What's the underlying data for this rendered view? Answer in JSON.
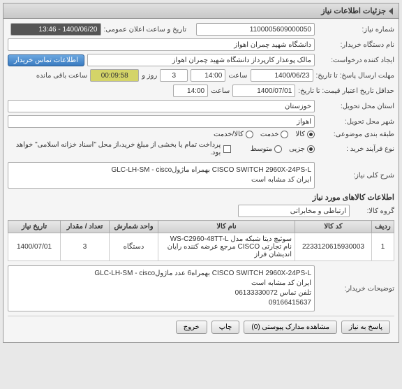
{
  "panel_title": "جزئیات اطلاعات نیاز",
  "fields": {
    "need_no_label": "شماره نیاز:",
    "need_no": "1100005609000050",
    "announce_label": "تاریخ و ساعت اعلان عمومی:",
    "announce": "1400/06/20 - 13:46",
    "buyer_org_label": "نام دستگاه خریدار:",
    "buyer_org": "دانشگاه شهید چمران اهواز",
    "creator_label": "ایجاد کننده درخواست:",
    "creator": "مالک پوعذار کارپرداز دانشگاه شهید چمران اهواز",
    "creator_btn": "اطلاعات تماس خریدار",
    "deadline_label": "مهلت ارسال پاسخ: تا تاریخ:",
    "deadline_date": "1400/06/23",
    "time_label": "ساعت",
    "deadline_time": "14:00",
    "days_label": "روز و",
    "days": "3",
    "remaining": "00:09:58",
    "remaining_label": "ساعت باقی مانده",
    "validity_label": "حداقل تاریخ اعتبار قیمت: تا تاریخ:",
    "validity_date": "1400/07/01",
    "validity_time": "14:00",
    "province_label": "استان محل تحویل:",
    "province": "خوزستان",
    "city_label": "شهر محل تحویل:",
    "city": "اهواز",
    "category_label": "طبقه بندی موضوعی:",
    "cat_goods": "کالا",
    "cat_service": "خدمت",
    "cat_both": "کالا/خدمت",
    "process_label": "نوع فرآیند خرید :",
    "proc_minor": "جزیی",
    "proc_medium": "متوسط",
    "payment_note": "پرداخت تمام یا بخشی از مبلغ خرید،از محل \"اسناد خزانه اسلامی\" خواهد بود."
  },
  "desc": {
    "label": "شرح کلی نیاز:",
    "text": "CISCO SWITCH 2960X-24PS-L بهمراه ماژولGLC-LH-SM - cisco\nایران کد مشابه است"
  },
  "goods_section": "اطلاعات کالاهای مورد نیاز",
  "group_label": "گروه کالا:",
  "group_value": "ارتباطی و مخابراتی",
  "table": {
    "headers": [
      "ردیف",
      "کد کالا",
      "نام کالا",
      "واحد شمارش",
      "تعداد / مقدار",
      "تاریخ نیاز"
    ],
    "row": {
      "idx": "1",
      "code": "2233120615930003",
      "name": "سوئیچ دیتا شبکه مدل WS-C2960-48TT-L نام تجارتی CISCO مرجع عرضه کننده رایان اندیشان فراز",
      "unit": "دستگاه",
      "qty": "3",
      "date": "1400/07/01"
    }
  },
  "buyer_notes": {
    "label": "توضیحات خریدار:",
    "text": "CISCO SWITCH 2960X-24PS-L بهمراه6 عدد ماژولGLC-LH-SM - cisco\nایران کد مشابه است\nتلفن تماس 06133330072\n09166415637"
  },
  "footer": {
    "reply": "پاسخ به نیاز",
    "attachments": "مشاهده مدارک پیوستی (0)",
    "print": "چاپ",
    "exit": "خروج"
  }
}
